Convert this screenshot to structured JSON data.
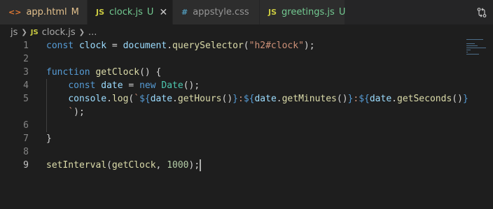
{
  "tabs": [
    {
      "icon": "<>",
      "label": "app.html",
      "status": "M",
      "color": "#e2c08d",
      "iconColor": "#e37933",
      "active": false,
      "width": 125
    },
    {
      "icon": "JS",
      "label": "clock.js",
      "status": "U",
      "color": "#73c991",
      "iconColor": "#cbcb41",
      "active": true,
      "width": 122,
      "close": "✕"
    },
    {
      "icon": "#",
      "label": "appstyle.css",
      "status": "",
      "color": "#969696",
      "iconColor": "#519aba",
      "active": false,
      "width": 124
    },
    {
      "icon": "JS",
      "label": "greetings.js",
      "status": "U",
      "color": "#73c991",
      "iconColor": "#cbcb41",
      "active": false,
      "width": 122
    }
  ],
  "breadcrumb": {
    "folder": "js",
    "file_icon": "JS",
    "file": "clock.js",
    "more": "..."
  },
  "colors": {
    "keyword": "#569cd6",
    "variable": "#9cdcfe",
    "function": "#dcdcaa",
    "string": "#ce9178",
    "number": "#b5cea8",
    "class": "#4ec9b0",
    "control": "#c586c0",
    "plain": "#d4d4d4"
  },
  "editor": {
    "current_line": 9,
    "lines": [
      {
        "num": "1",
        "tokens": [
          [
            "const",
            "keyword"
          ],
          [
            " ",
            "plain"
          ],
          [
            "clock",
            "variable"
          ],
          [
            " = ",
            "plain"
          ],
          [
            "document",
            "variable"
          ],
          [
            ".",
            "plain"
          ],
          [
            "querySelector",
            "function"
          ],
          [
            "(",
            "plain"
          ],
          [
            "\"h2#clock\"",
            "string"
          ],
          [
            ");",
            "plain"
          ]
        ]
      },
      {
        "num": "2",
        "tokens": []
      },
      {
        "num": "3",
        "tokens": [
          [
            "function",
            "keyword"
          ],
          [
            " ",
            "plain"
          ],
          [
            "getClock",
            "function"
          ],
          [
            "() {",
            "plain"
          ]
        ]
      },
      {
        "num": "4",
        "tokens": [
          [
            "    ",
            "plain"
          ],
          [
            "const",
            "keyword"
          ],
          [
            " ",
            "plain"
          ],
          [
            "date",
            "variable"
          ],
          [
            " = ",
            "plain"
          ],
          [
            "new",
            "keyword"
          ],
          [
            " ",
            "plain"
          ],
          [
            "Date",
            "class"
          ],
          [
            "();",
            "plain"
          ]
        ]
      },
      {
        "num": "5",
        "tokens": [
          [
            "    ",
            "plain"
          ],
          [
            "console",
            "variable"
          ],
          [
            ".",
            "plain"
          ],
          [
            "log",
            "function"
          ],
          [
            "(",
            "plain"
          ],
          [
            "`",
            "string"
          ],
          [
            "${",
            "keyword"
          ],
          [
            "date",
            "variable"
          ],
          [
            ".",
            "plain"
          ],
          [
            "getHours",
            "function"
          ],
          [
            "()",
            "plain"
          ],
          [
            "}",
            "keyword"
          ],
          [
            ":",
            "string"
          ],
          [
            "${",
            "keyword"
          ],
          [
            "date",
            "variable"
          ],
          [
            ".",
            "plain"
          ],
          [
            "getMinutes",
            "function"
          ],
          [
            "()",
            "plain"
          ],
          [
            "}",
            "keyword"
          ],
          [
            ":",
            "string"
          ],
          [
            "${",
            "keyword"
          ],
          [
            "date",
            "variable"
          ],
          [
            ".",
            "plain"
          ],
          [
            "getSeconds",
            "function"
          ],
          [
            "()",
            "plain"
          ],
          [
            "}",
            "keyword"
          ]
        ]
      },
      {
        "num": "",
        "tokens": [
          [
            "    ",
            "plain"
          ],
          [
            "`",
            "string"
          ],
          [
            ");",
            "plain"
          ]
        ]
      },
      {
        "num": "6",
        "tokens": []
      },
      {
        "num": "7",
        "tokens": [
          [
            "}",
            "plain"
          ]
        ]
      },
      {
        "num": "8",
        "tokens": []
      },
      {
        "num": "9",
        "tokens": [
          [
            "setInterval",
            "function"
          ],
          [
            "(",
            "plain"
          ],
          [
            "getClock",
            "function"
          ],
          [
            ", ",
            "plain"
          ],
          [
            "1000",
            "number"
          ],
          [
            ");",
            "plain"
          ]
        ],
        "cursor": true
      }
    ]
  }
}
